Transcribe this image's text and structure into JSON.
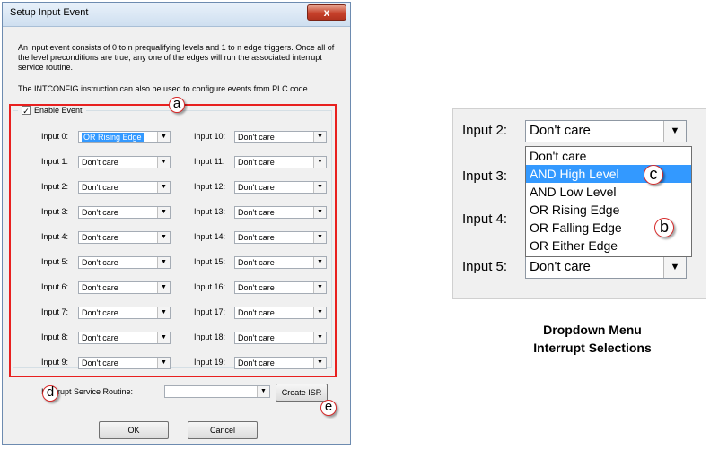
{
  "dialog": {
    "title": "Setup Input Event",
    "close_label": "x",
    "description_1": "An input event consists of 0 to n prequalifying levels and 1 to n edge triggers. Once all of the level preconditions are true, any one of the edges will run the associated interrupt service routine.",
    "description_2": "The INTCONFIG instruction can also be used to configure events from PLC code.",
    "enable_event": {
      "label": "Enable Event",
      "checked": true
    },
    "inputs_left": [
      {
        "label": "Input 0:",
        "value": "OR Rising Edge",
        "selected": true
      },
      {
        "label": "Input 1:",
        "value": "Don't care"
      },
      {
        "label": "Input 2:",
        "value": "Don't care"
      },
      {
        "label": "Input 3:",
        "value": "Don't care"
      },
      {
        "label": "Input 4:",
        "value": "Don't care"
      },
      {
        "label": "Input 5:",
        "value": "Don't care"
      },
      {
        "label": "Input 6:",
        "value": "Don't care"
      },
      {
        "label": "Input 7:",
        "value": "Don't care"
      },
      {
        "label": "Input 8:",
        "value": "Don't care"
      },
      {
        "label": "Input 9:",
        "value": "Don't care"
      }
    ],
    "inputs_right": [
      {
        "label": "Input 10:",
        "value": "Don't care"
      },
      {
        "label": "Input 11:",
        "value": "Don't care"
      },
      {
        "label": "Input 12:",
        "value": "Don't care"
      },
      {
        "label": "Input 13:",
        "value": "Don't care"
      },
      {
        "label": "Input 14:",
        "value": "Don't care"
      },
      {
        "label": "Input 15:",
        "value": "Don't care"
      },
      {
        "label": "Input 16:",
        "value": "Don't care"
      },
      {
        "label": "Input 17:",
        "value": "Don't care"
      },
      {
        "label": "Input 18:",
        "value": "Don't care"
      },
      {
        "label": "Input 19:",
        "value": "Don't care"
      }
    ],
    "isr_label": "Interrupt Service Routine:",
    "isr_value": "",
    "create_isr_label": "Create ISR",
    "ok_label": "OK",
    "cancel_label": "Cancel",
    "arrow_glyph": "▼"
  },
  "callouts": {
    "a": "a",
    "b": "b",
    "c": "c",
    "d": "d",
    "e": "e"
  },
  "zoom": {
    "input2_label": "Input 2:",
    "input2_value": "Don't care",
    "input3_label": "Input 3:",
    "input4_label": "Input 4:",
    "input5_label": "Input 5:",
    "input5_value": "Don't care",
    "options": [
      "Don't care",
      "AND High Level",
      "AND Low Level",
      "OR Rising Edge",
      "OR Falling Edge",
      "OR Either Edge"
    ],
    "highlighted_option": "AND High Level"
  },
  "caption": {
    "line1": "Dropdown Menu",
    "line2": "Interrupt Selections"
  },
  "colors": {
    "highlight": "#3399ff",
    "callout_border_red": "#d62828",
    "frame_red": "#e8201f"
  }
}
